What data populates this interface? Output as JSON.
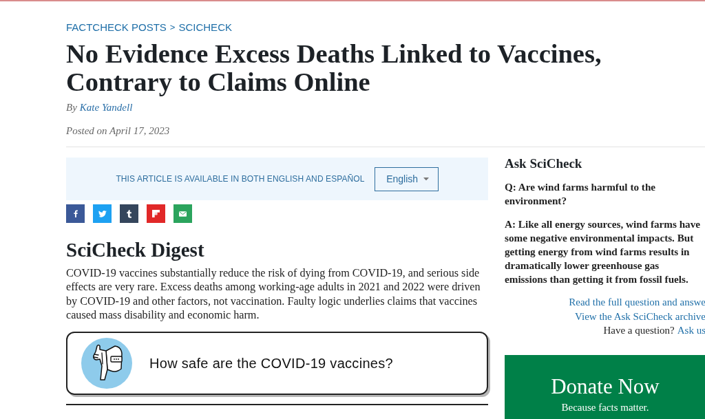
{
  "breadcrumb": {
    "items": [
      "FACTCHECK POSTS",
      "SCICHECK"
    ],
    "separator": ">"
  },
  "article": {
    "title": "No Evidence Excess Deaths Linked to Vaccines, Contrary to Claims Online",
    "byline": {
      "prefix": "By",
      "author": "Kate Yandell"
    },
    "posted": "Posted on April 17, 2023"
  },
  "language_banner": {
    "text": "THIS ARTICLE IS AVAILABLE IN BOTH ENGLISH AND ESPAÑOL",
    "language_select": {
      "value": "English"
    }
  },
  "share_buttons": [
    {
      "kind": "facebook"
    },
    {
      "kind": "twitter"
    },
    {
      "kind": "tumblr"
    },
    {
      "kind": "flipboard"
    },
    {
      "kind": "email"
    }
  ],
  "digest": {
    "heading": "SciCheck Digest",
    "text": "COVID-19 vaccines substantially reduce the risk of dying from COVID-19, and serious side effects are very rare. Excess deaths among working-age adults in 2021 and 2022 were driven by COVID-19 and other factors, not vaccination. Faulty logic underlies claims that vaccines caused mass disability and economic harm."
  },
  "question_card": {
    "text": "How safe are the COVID-19 vaccines?"
  },
  "sidebar": {
    "ask_scicheck": {
      "heading": "Ask SciCheck",
      "question": "Q: Are wind farms harmful to the environment?",
      "answer": "A: Like all energy sources, wind farms have some negative environmental impacts. But getting energy from wind farms results in dramatically lower greenhouse gas emissions than getting it from fossil fuels.",
      "links": [
        "Read the full question and answe",
        "View the Ask SciCheck archive"
      ],
      "prompt": {
        "text": "Have a question?",
        "link": "Ask us"
      }
    },
    "donate": {
      "title": "Donate Now",
      "subtitle": "Because facts matter."
    }
  }
}
